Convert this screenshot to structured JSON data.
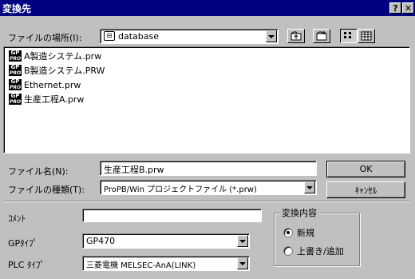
{
  "window": {
    "title": "変換先",
    "help_icon": "help-icon",
    "close_icon": "close-icon"
  },
  "lookin": {
    "label": "ファイルの場所(I):",
    "value": "database",
    "folder_icon": "network-folder-icon"
  },
  "toolbar": {
    "up_icon": "up-folder-icon",
    "newfolder_icon": "new-folder-icon",
    "list_icon": "list-view-icon",
    "details_icon": "details-view-icon"
  },
  "files": [
    {
      "name": "A製造システム.prw",
      "icon": "gp-file-icon",
      "icon_top": "GP",
      "icon_bot": "PRO"
    },
    {
      "name": "B製造システム.PRW",
      "icon": "gp-file-icon",
      "icon_top": "GP",
      "icon_bot": "PRO"
    },
    {
      "name": "Ethernet.prw",
      "icon": "gp-file-icon",
      "icon_top": "GP",
      "icon_bot": "PRO"
    },
    {
      "name": "生産工程A.prw",
      "icon": "gp-file-icon",
      "icon_top": "GP",
      "icon_bot": "PRO"
    }
  ],
  "filename": {
    "label": "ファイル名(N):",
    "value": "生産工程B.prw"
  },
  "filetype": {
    "label": "ファイルの種類(T):",
    "value": "ProPB/Win プロジェクトファイル (*.prw)"
  },
  "buttons": {
    "ok": "OK",
    "cancel": "ｷｬﾝｾﾙ"
  },
  "comment": {
    "label": "ｺﾒﾝﾄ",
    "value": ""
  },
  "gptype": {
    "label": "GPﾀｲﾌﾟ",
    "value": "GP470"
  },
  "plctype": {
    "label": "PLC ﾀｲﾌﾟ",
    "value": "三菱電機 MELSEC-AnA(LINK)"
  },
  "convert": {
    "group_label": "変換内容",
    "options": [
      "新規",
      "上書き/追加"
    ],
    "selected": "新規"
  }
}
